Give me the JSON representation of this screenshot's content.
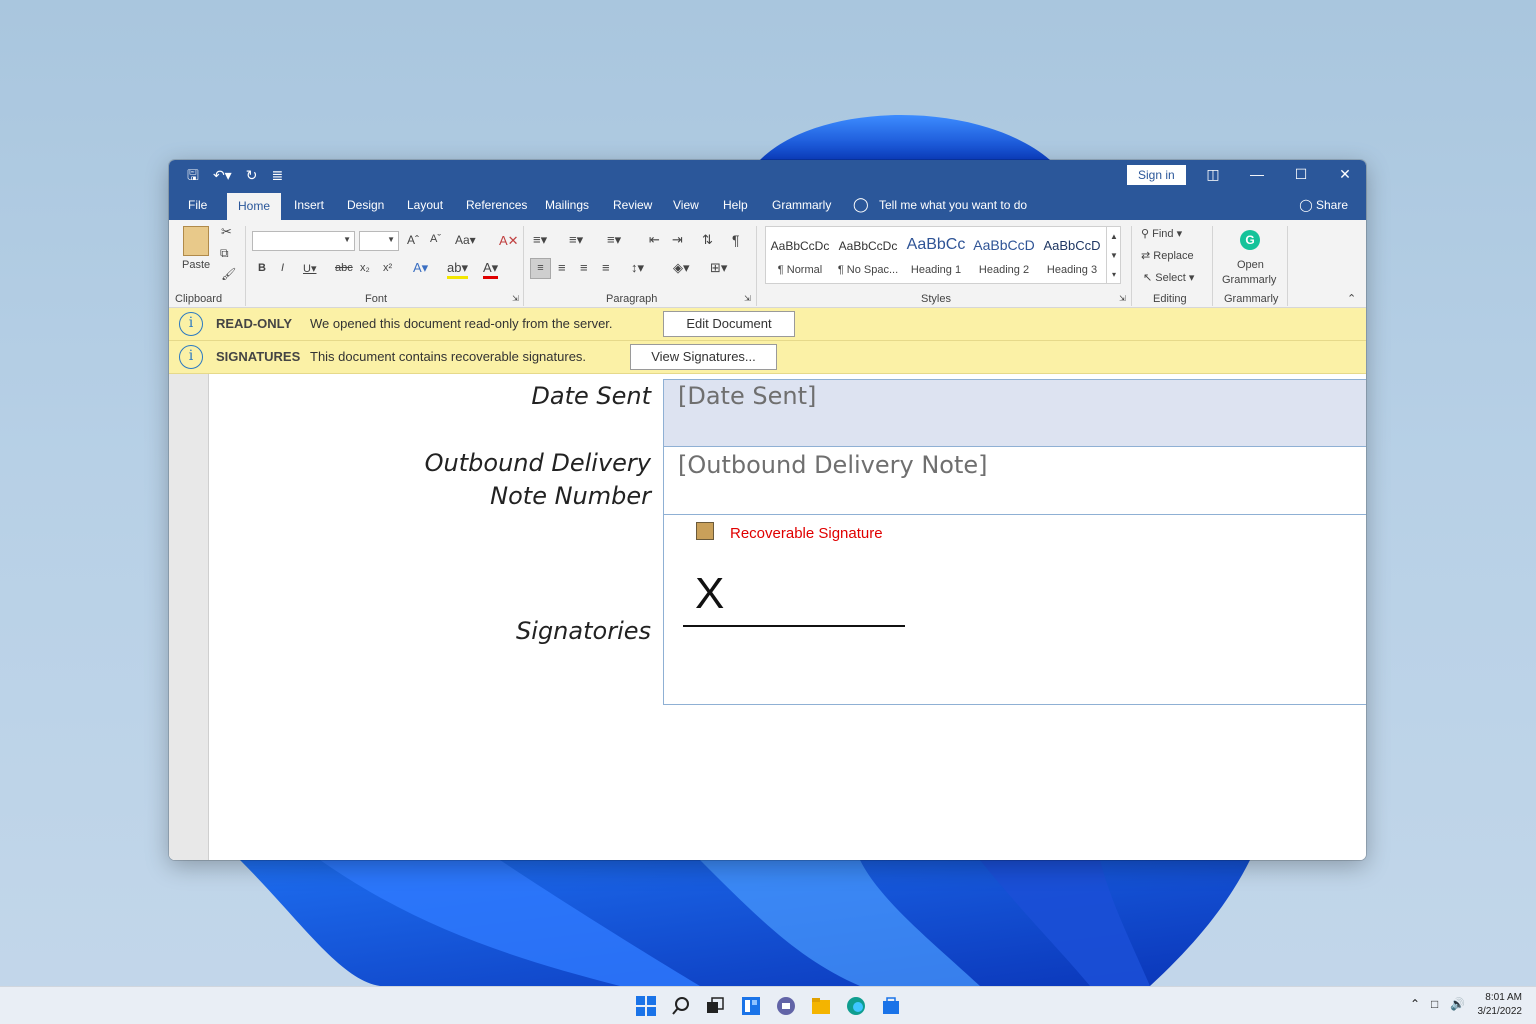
{
  "window": {
    "signin": "Sign in",
    "share": "Share"
  },
  "qat": {
    "more": "≣"
  },
  "tabs": [
    "File",
    "Home",
    "Insert",
    "Design",
    "Layout",
    "References",
    "Mailings",
    "Review",
    "View",
    "Help",
    "Grammarly"
  ],
  "tell_me": "Tell me what you want to do",
  "ribbon": {
    "clipboard": {
      "label": "Clipboard",
      "paste": "Paste"
    },
    "font": {
      "label": "Font"
    },
    "paragraph": {
      "label": "Paragraph"
    },
    "styles": {
      "label": "Styles",
      "items": [
        {
          "sample": "AaBbCcDc",
          "name": "¶ Normal"
        },
        {
          "sample": "AaBbCcDc",
          "name": "¶ No Spac..."
        },
        {
          "sample": "AaBbCc",
          "name": "Heading 1"
        },
        {
          "sample": "AaBbCcD",
          "name": "Heading 2"
        },
        {
          "sample": "AaBbCcD",
          "name": "Heading 3"
        }
      ]
    },
    "editing": {
      "label": "Editing",
      "find": "Find",
      "replace": "Replace",
      "select": "Select"
    },
    "grammarly": {
      "label": "Grammarly",
      "open_line1": "Open",
      "open_line2": "Grammarly"
    }
  },
  "messages": [
    {
      "title": "READ-ONLY",
      "text": "We opened this document read-only from the server.",
      "button": "Edit Document"
    },
    {
      "title": "SIGNATURES",
      "text": "This document contains recoverable signatures.",
      "button": "View Signatures..."
    }
  ],
  "document": {
    "date_sent_label": "Date Sent",
    "date_sent_placeholder": "[Date Sent]",
    "delivery_label_1": "Outbound Delivery",
    "delivery_label_2": "Note Number",
    "delivery_placeholder": "[Outbound Delivery Note]",
    "signatories_label": "Signatories",
    "recoverable_signature": "Recoverable Signature",
    "signature_x": "X"
  },
  "taskbar": {
    "time": "8:01 AM",
    "date": "3/21/2022"
  }
}
